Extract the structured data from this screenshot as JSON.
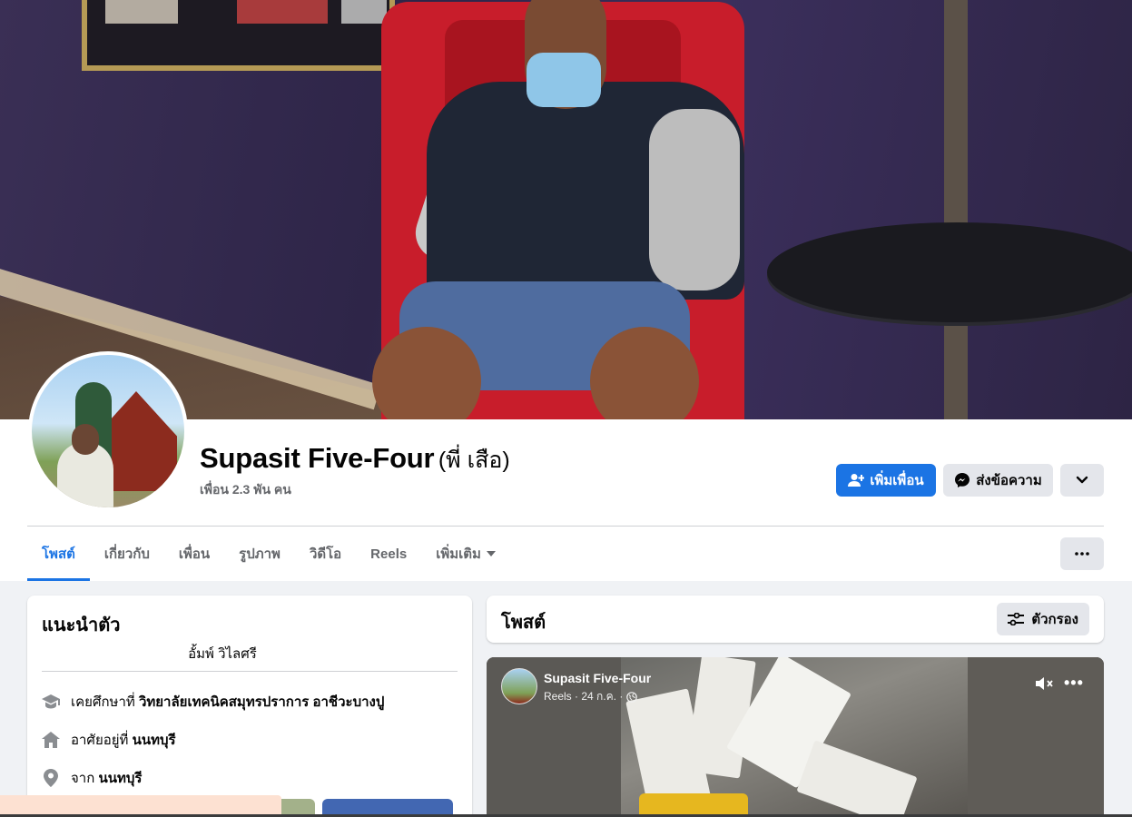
{
  "profile": {
    "name": "Supasit Five-Four",
    "nickname": "(พี่ เสือ)",
    "friends": "เพื่อน 2.3 พัน คน"
  },
  "actions": {
    "add_friend": "เพิ่มเพื่อน",
    "message": "ส่งข้อความ"
  },
  "tabs": [
    {
      "label": "โพสต์",
      "active": true
    },
    {
      "label": "เกี่ยวกับ"
    },
    {
      "label": "เพื่อน"
    },
    {
      "label": "รูปภาพ"
    },
    {
      "label": "วิดีโอ"
    },
    {
      "label": "Reels"
    },
    {
      "label": "เพิ่มเติม"
    }
  ],
  "intro": {
    "title": "แนะนำตัว",
    "bio": "อั้มพ์ วิไลศรี",
    "education_prefix": "เคยศึกษาที่",
    "education_value": "วิทยาลัยเทคนิคสมุทรปราการ อาชีวะบางปู",
    "lives_prefix": "อาศัยอยู่ที่",
    "lives_value": "นนทบุรี",
    "from_prefix": "จาก",
    "from_value": "นนทบุรี"
  },
  "posts": {
    "title": "โพสต์",
    "filter_label": "ตัวกรอง"
  },
  "reel": {
    "author": "Supasit Five-Four",
    "meta": "Reels · 24 ก.ค. ·",
    "more": "•••"
  },
  "colors": {
    "accent": "#1b74e4",
    "secondary_button": "#e4e6eb",
    "page_bg": "#f0f2f5"
  }
}
